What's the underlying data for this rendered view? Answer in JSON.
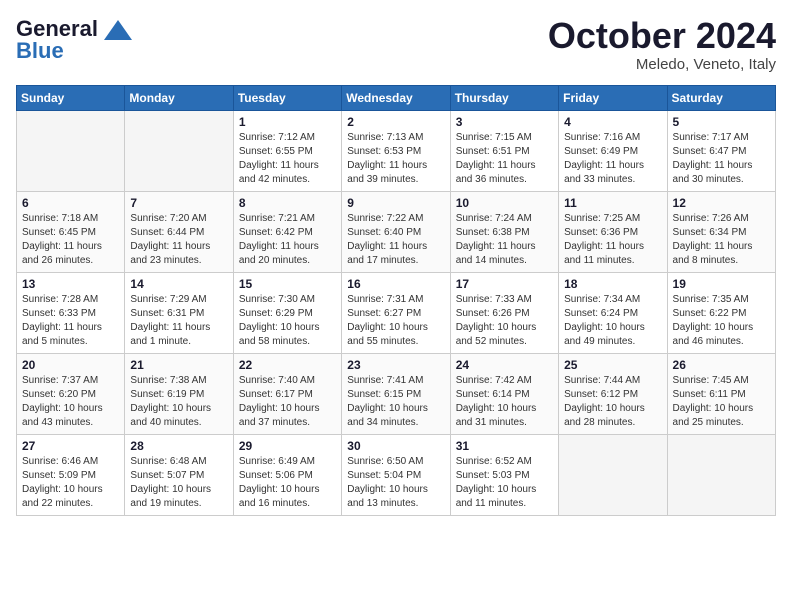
{
  "header": {
    "logo_general": "General",
    "logo_blue": "Blue",
    "month": "October 2024",
    "location": "Meledo, Veneto, Italy"
  },
  "days_of_week": [
    "Sunday",
    "Monday",
    "Tuesday",
    "Wednesday",
    "Thursday",
    "Friday",
    "Saturday"
  ],
  "weeks": [
    [
      {
        "day": "",
        "empty": true
      },
      {
        "day": "",
        "empty": true
      },
      {
        "day": "1",
        "sunrise": "Sunrise: 7:12 AM",
        "sunset": "Sunset: 6:55 PM",
        "daylight": "Daylight: 11 hours and 42 minutes."
      },
      {
        "day": "2",
        "sunrise": "Sunrise: 7:13 AM",
        "sunset": "Sunset: 6:53 PM",
        "daylight": "Daylight: 11 hours and 39 minutes."
      },
      {
        "day": "3",
        "sunrise": "Sunrise: 7:15 AM",
        "sunset": "Sunset: 6:51 PM",
        "daylight": "Daylight: 11 hours and 36 minutes."
      },
      {
        "day": "4",
        "sunrise": "Sunrise: 7:16 AM",
        "sunset": "Sunset: 6:49 PM",
        "daylight": "Daylight: 11 hours and 33 minutes."
      },
      {
        "day": "5",
        "sunrise": "Sunrise: 7:17 AM",
        "sunset": "Sunset: 6:47 PM",
        "daylight": "Daylight: 11 hours and 30 minutes."
      }
    ],
    [
      {
        "day": "6",
        "sunrise": "Sunrise: 7:18 AM",
        "sunset": "Sunset: 6:45 PM",
        "daylight": "Daylight: 11 hours and 26 minutes."
      },
      {
        "day": "7",
        "sunrise": "Sunrise: 7:20 AM",
        "sunset": "Sunset: 6:44 PM",
        "daylight": "Daylight: 11 hours and 23 minutes."
      },
      {
        "day": "8",
        "sunrise": "Sunrise: 7:21 AM",
        "sunset": "Sunset: 6:42 PM",
        "daylight": "Daylight: 11 hours and 20 minutes."
      },
      {
        "day": "9",
        "sunrise": "Sunrise: 7:22 AM",
        "sunset": "Sunset: 6:40 PM",
        "daylight": "Daylight: 11 hours and 17 minutes."
      },
      {
        "day": "10",
        "sunrise": "Sunrise: 7:24 AM",
        "sunset": "Sunset: 6:38 PM",
        "daylight": "Daylight: 11 hours and 14 minutes."
      },
      {
        "day": "11",
        "sunrise": "Sunrise: 7:25 AM",
        "sunset": "Sunset: 6:36 PM",
        "daylight": "Daylight: 11 hours and 11 minutes."
      },
      {
        "day": "12",
        "sunrise": "Sunrise: 7:26 AM",
        "sunset": "Sunset: 6:34 PM",
        "daylight": "Daylight: 11 hours and 8 minutes."
      }
    ],
    [
      {
        "day": "13",
        "sunrise": "Sunrise: 7:28 AM",
        "sunset": "Sunset: 6:33 PM",
        "daylight": "Daylight: 11 hours and 5 minutes."
      },
      {
        "day": "14",
        "sunrise": "Sunrise: 7:29 AM",
        "sunset": "Sunset: 6:31 PM",
        "daylight": "Daylight: 11 hours and 1 minute."
      },
      {
        "day": "15",
        "sunrise": "Sunrise: 7:30 AM",
        "sunset": "Sunset: 6:29 PM",
        "daylight": "Daylight: 10 hours and 58 minutes."
      },
      {
        "day": "16",
        "sunrise": "Sunrise: 7:31 AM",
        "sunset": "Sunset: 6:27 PM",
        "daylight": "Daylight: 10 hours and 55 minutes."
      },
      {
        "day": "17",
        "sunrise": "Sunrise: 7:33 AM",
        "sunset": "Sunset: 6:26 PM",
        "daylight": "Daylight: 10 hours and 52 minutes."
      },
      {
        "day": "18",
        "sunrise": "Sunrise: 7:34 AM",
        "sunset": "Sunset: 6:24 PM",
        "daylight": "Daylight: 10 hours and 49 minutes."
      },
      {
        "day": "19",
        "sunrise": "Sunrise: 7:35 AM",
        "sunset": "Sunset: 6:22 PM",
        "daylight": "Daylight: 10 hours and 46 minutes."
      }
    ],
    [
      {
        "day": "20",
        "sunrise": "Sunrise: 7:37 AM",
        "sunset": "Sunset: 6:20 PM",
        "daylight": "Daylight: 10 hours and 43 minutes."
      },
      {
        "day": "21",
        "sunrise": "Sunrise: 7:38 AM",
        "sunset": "Sunset: 6:19 PM",
        "daylight": "Daylight: 10 hours and 40 minutes."
      },
      {
        "day": "22",
        "sunrise": "Sunrise: 7:40 AM",
        "sunset": "Sunset: 6:17 PM",
        "daylight": "Daylight: 10 hours and 37 minutes."
      },
      {
        "day": "23",
        "sunrise": "Sunrise: 7:41 AM",
        "sunset": "Sunset: 6:15 PM",
        "daylight": "Daylight: 10 hours and 34 minutes."
      },
      {
        "day": "24",
        "sunrise": "Sunrise: 7:42 AM",
        "sunset": "Sunset: 6:14 PM",
        "daylight": "Daylight: 10 hours and 31 minutes."
      },
      {
        "day": "25",
        "sunrise": "Sunrise: 7:44 AM",
        "sunset": "Sunset: 6:12 PM",
        "daylight": "Daylight: 10 hours and 28 minutes."
      },
      {
        "day": "26",
        "sunrise": "Sunrise: 7:45 AM",
        "sunset": "Sunset: 6:11 PM",
        "daylight": "Daylight: 10 hours and 25 minutes."
      }
    ],
    [
      {
        "day": "27",
        "sunrise": "Sunrise: 6:46 AM",
        "sunset": "Sunset: 5:09 PM",
        "daylight": "Daylight: 10 hours and 22 minutes."
      },
      {
        "day": "28",
        "sunrise": "Sunrise: 6:48 AM",
        "sunset": "Sunset: 5:07 PM",
        "daylight": "Daylight: 10 hours and 19 minutes."
      },
      {
        "day": "29",
        "sunrise": "Sunrise: 6:49 AM",
        "sunset": "Sunset: 5:06 PM",
        "daylight": "Daylight: 10 hours and 16 minutes."
      },
      {
        "day": "30",
        "sunrise": "Sunrise: 6:50 AM",
        "sunset": "Sunset: 5:04 PM",
        "daylight": "Daylight: 10 hours and 13 minutes."
      },
      {
        "day": "31",
        "sunrise": "Sunrise: 6:52 AM",
        "sunset": "Sunset: 5:03 PM",
        "daylight": "Daylight: 10 hours and 11 minutes."
      },
      {
        "day": "",
        "empty": true
      },
      {
        "day": "",
        "empty": true
      }
    ]
  ]
}
